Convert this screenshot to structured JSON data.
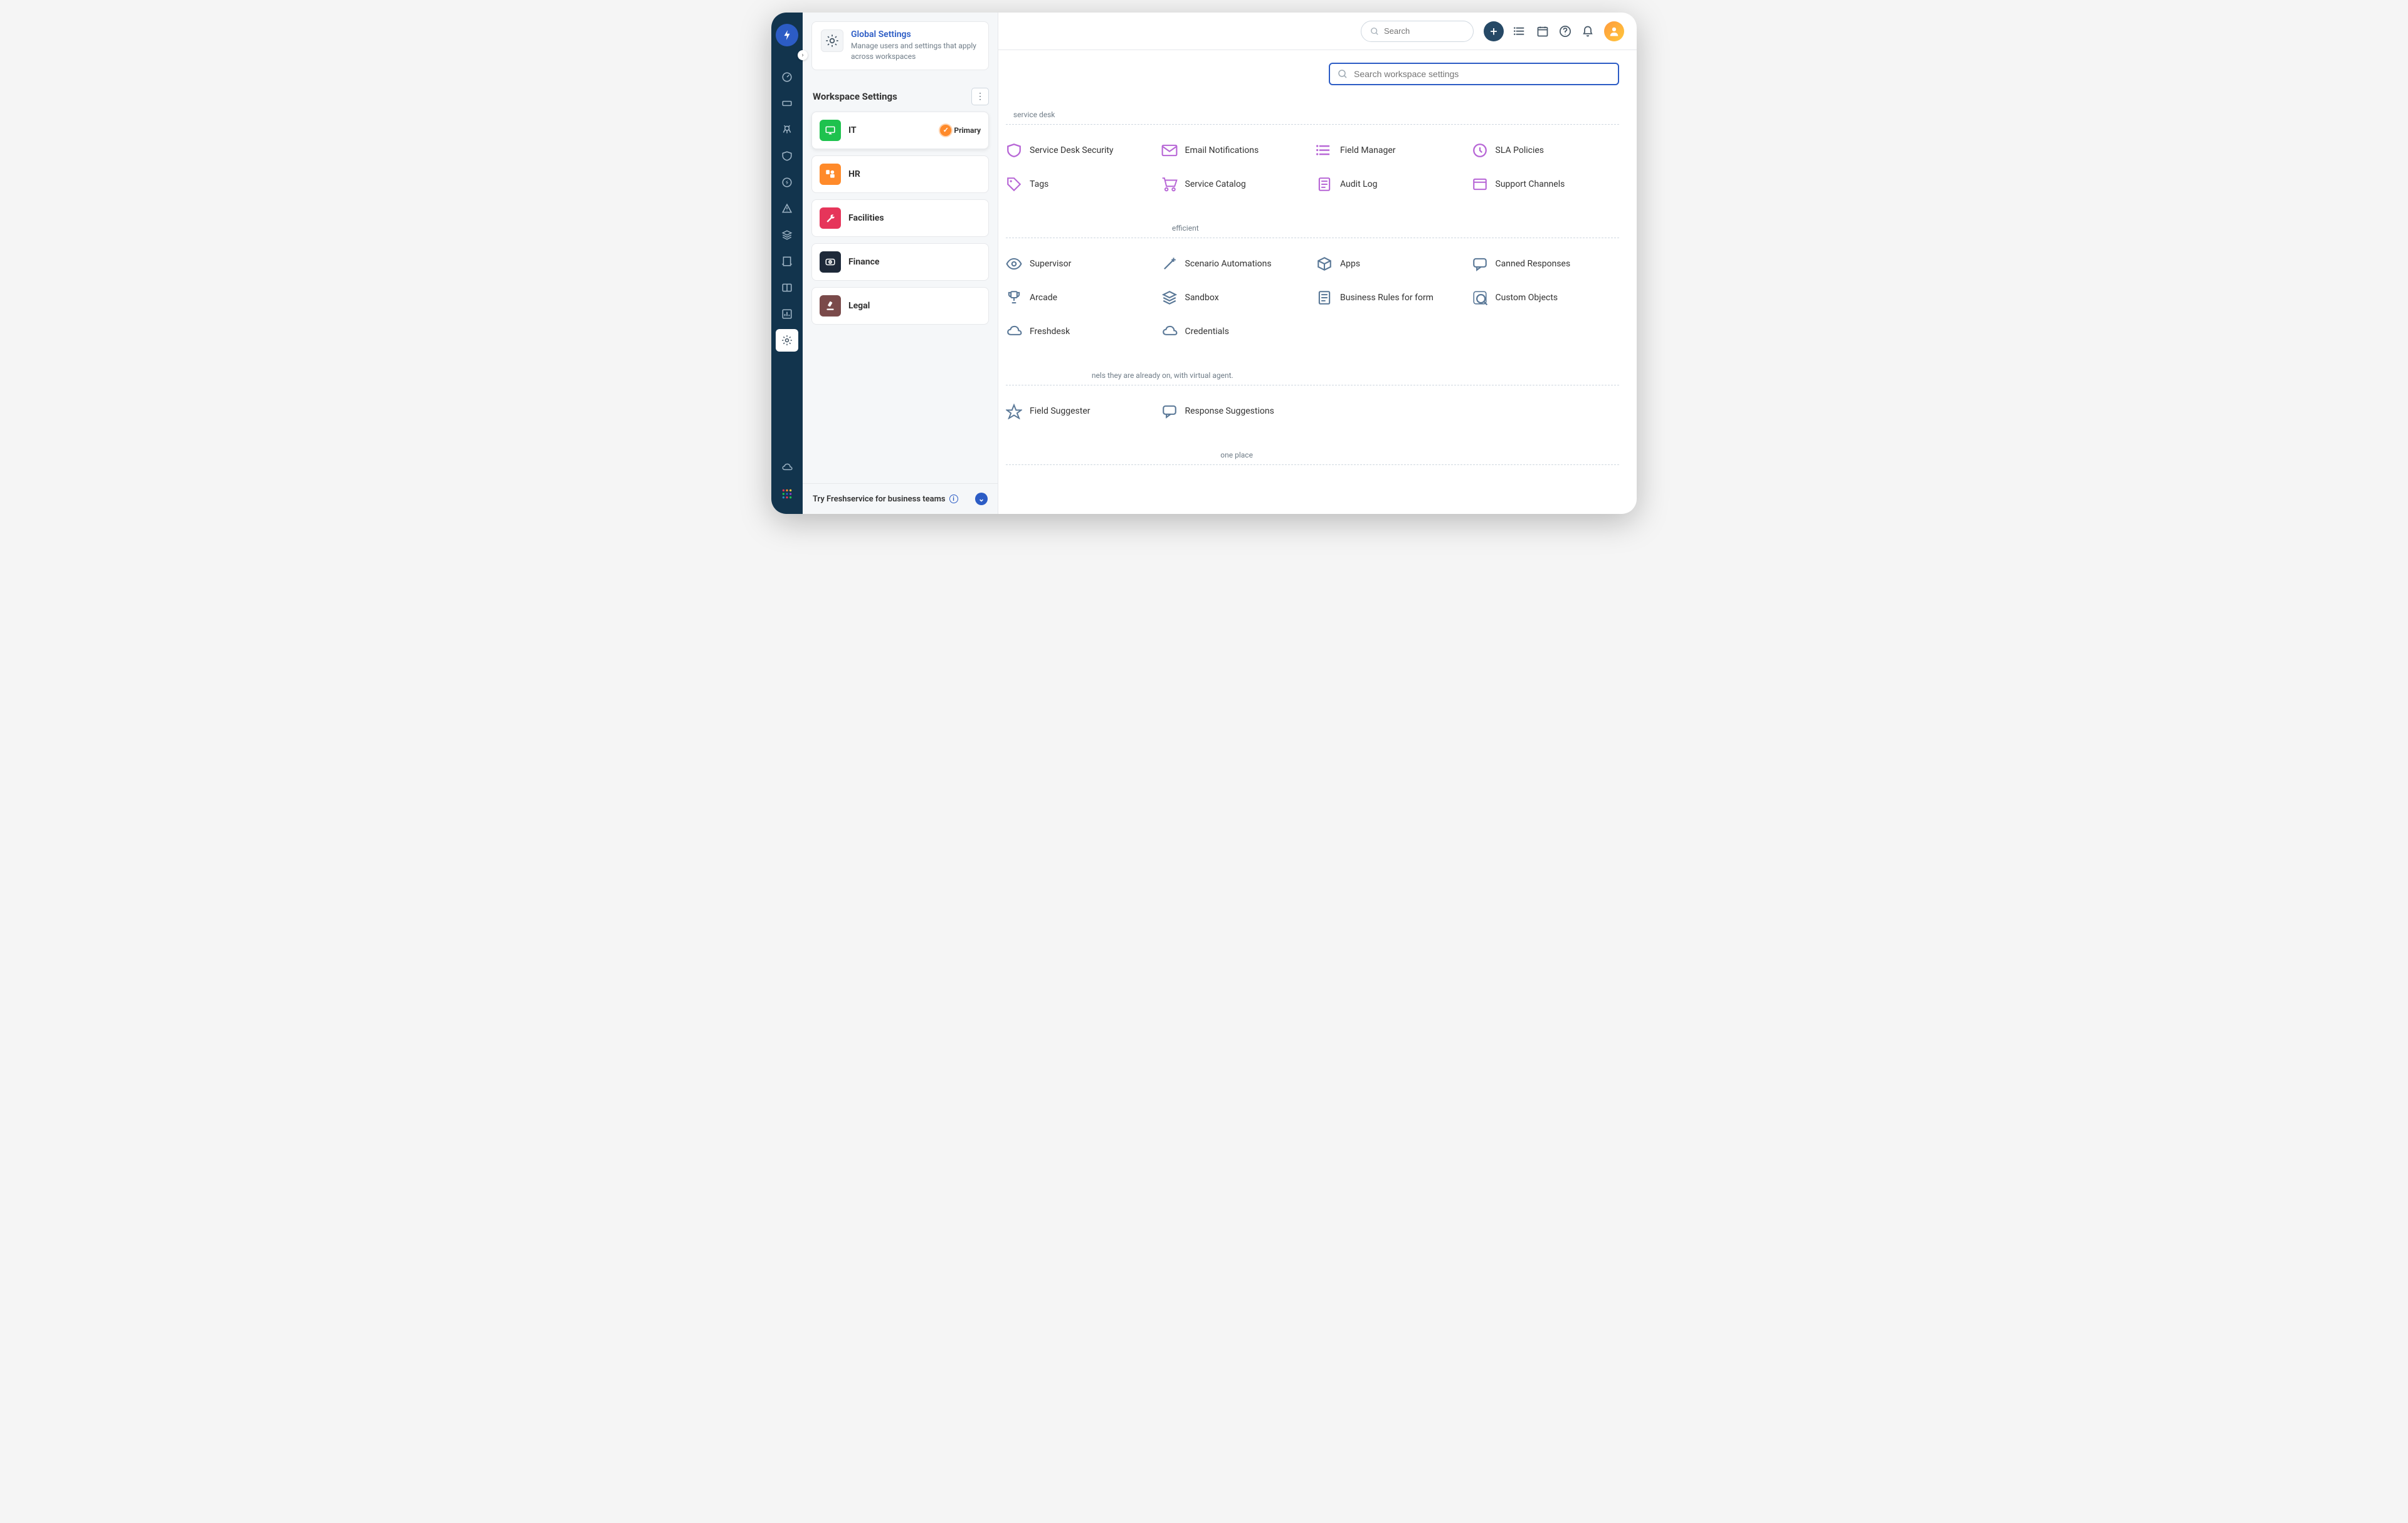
{
  "header": {
    "search_placeholder": "Search",
    "add_label": "+"
  },
  "rail": {
    "expand_glyph": "›"
  },
  "global": {
    "title": "Global Settings",
    "description": "Manage users and settings that apply across workspaces"
  },
  "workspace": {
    "header": "Workspace Settings",
    "primary_label": "Primary",
    "items": [
      {
        "name": "IT",
        "color": "#1ec24e",
        "icon": "monitor",
        "primary": true
      },
      {
        "name": "HR",
        "color": "#ff8a2a",
        "icon": "users",
        "primary": false
      },
      {
        "name": "Facilities",
        "color": "#e6355a",
        "icon": "wrench",
        "primary": false
      },
      {
        "name": "Finance",
        "color": "#1e2939",
        "icon": "money",
        "primary": false
      },
      {
        "name": "Legal",
        "color": "#7a4a4a",
        "icon": "gavel",
        "primary": false
      }
    ]
  },
  "footer": {
    "try_text": "Try Freshservice for business teams"
  },
  "settings_search": {
    "placeholder": "Search workspace settings"
  },
  "sections": [
    {
      "description": "    service desk",
      "items": [
        {
          "label": "Service Desk Security"
        },
        {
          "label": "Email Notifications"
        },
        {
          "label": "Field Manager"
        },
        {
          "label": "SLA Policies"
        },
        {
          "label": "Tags"
        },
        {
          "label": "Service Catalog"
        },
        {
          "label": "Audit Log"
        },
        {
          "label": "Support Channels"
        }
      ]
    },
    {
      "description": "                                                                                         efficient",
      "items": [
        {
          "label": "Supervisor"
        },
        {
          "label": "Scenario Automations"
        },
        {
          "label": "Apps"
        },
        {
          "label": "Canned Responses"
        },
        {
          "label": "Arcade"
        },
        {
          "label": "Sandbox"
        },
        {
          "label": "Business Rules for form"
        },
        {
          "label": "Custom Objects"
        },
        {
          "label": "Freshdesk"
        },
        {
          "label": "Credentials"
        }
      ]
    },
    {
      "description": "                                              nels they are already on, with virtual agent.",
      "items": [
        {
          "label": "Field Suggester"
        },
        {
          "label": "Response Suggestions"
        }
      ]
    },
    {
      "description": "                                                                                                                   one place"
    }
  ]
}
